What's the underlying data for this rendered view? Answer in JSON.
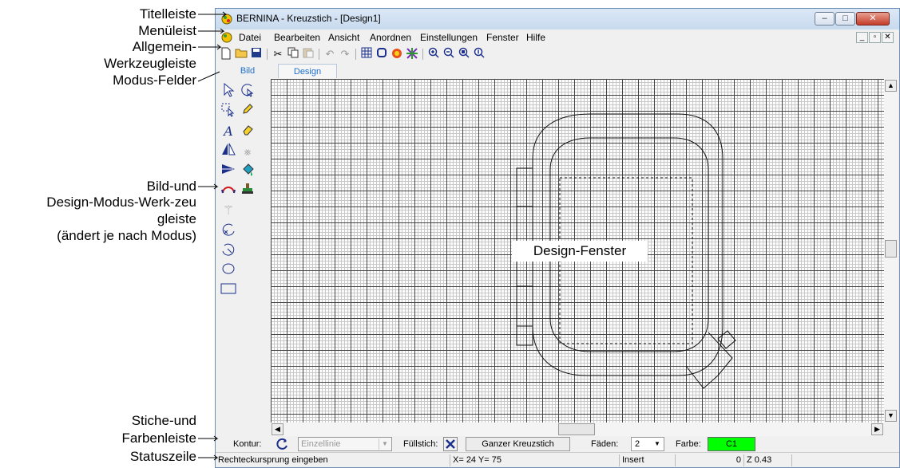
{
  "annotations": {
    "titelleiste": "Titelleiste",
    "menueleiste": "Menüleist",
    "allgemein_line1": "Allgemein-",
    "allgemein_line2": "Werkzeugleiste",
    "modus_felder": "Modus-Felder",
    "bild_design_line1": "Bild-und",
    "bild_design_line2": "Design-Modus-Werk-zeu",
    "bild_design_line3": "gleiste",
    "bild_design_line4": "(ändert je nach Modus)",
    "stiche_line1": "Stiche-und",
    "stiche_line2": "Farbenleiste",
    "statuszeile": "Statuszeile"
  },
  "window": {
    "title": "BERNINA - Kreuzstich - [Design1]",
    "controls": [
      "minimize",
      "maximize",
      "close"
    ]
  },
  "menubar": {
    "items": [
      "Datei",
      "Bearbeiten",
      "Ansicht",
      "Anordnen",
      "Einstellungen",
      "Fenster",
      "Hilfe"
    ]
  },
  "toolbar": {
    "icons": [
      "new-icon",
      "open-icon",
      "save-icon",
      "cut-icon",
      "copy-icon",
      "paste-icon",
      "undo-icon",
      "redo-icon",
      "grid-icon",
      "hoop-icon",
      "color-icon",
      "pattern-icon",
      "zoom-in-icon",
      "zoom-out-icon",
      "zoom-fit-icon",
      "zoom-100-icon"
    ]
  },
  "mode_tabs": {
    "bild": "Bild",
    "design": "Design"
  },
  "canvas": {
    "label": "Design-Fenster"
  },
  "stitchbar": {
    "kontur_label": "Kontur:",
    "kontur_value": "Einzellinie",
    "fuellstich_label": "Füllstich:",
    "full_cross_button": "Ganzer Kreuzstich",
    "faeden_label": "Fäden:",
    "faeden_value": "2",
    "farbe_label": "Farbe:",
    "farbe_value": "C1",
    "farbe_color": "#00ff00"
  },
  "statusbar": {
    "message": "Rechteckursprung eingeben",
    "coords": "X= 24  Y= 75",
    "mode": "Insert",
    "count": "0",
    "zoom": "Z 0.43"
  }
}
